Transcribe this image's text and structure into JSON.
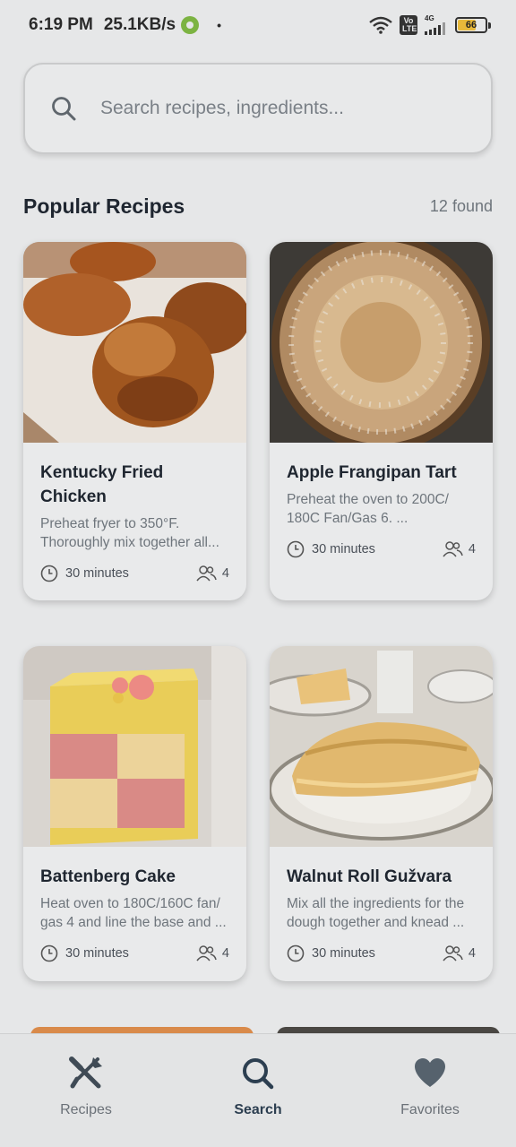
{
  "status_bar": {
    "time": "6:19 PM",
    "speed": "25.1KB/s",
    "network": "4G",
    "volte": "Vo LTE",
    "battery": "66",
    "battery_level": 0.66
  },
  "search": {
    "placeholder": "Search recipes, ingredients..."
  },
  "section": {
    "title": "Popular Recipes",
    "count": "12 found"
  },
  "recipes": [
    {
      "title": "Kentucky Fried Chicken",
      "description": "Preheat fryer to 350°F. Thoroughly mix together all...",
      "time": "30 minutes",
      "servings": "4"
    },
    {
      "title": "Apple Frangipan Tart",
      "description": "Preheat the oven to 200C/ 180C Fan/Gas 6. ...",
      "time": "30 minutes",
      "servings": "4"
    },
    {
      "title": "Battenberg Cake",
      "description": "Heat oven to 180C/160C fan/ gas 4 and line the base and ...",
      "time": "30 minutes",
      "servings": "4"
    },
    {
      "title": "Walnut Roll Gužvara",
      "description": "Mix all the ingredients for the dough together and knead ...",
      "time": "30 minutes",
      "servings": "4"
    }
  ],
  "nav": {
    "items": [
      {
        "label": "Recipes",
        "icon": "fork-knife-icon",
        "active": false
      },
      {
        "label": "Search",
        "icon": "search-icon",
        "active": true
      },
      {
        "label": "Favorites",
        "icon": "heart-icon",
        "active": false
      }
    ]
  },
  "colors": {
    "background": "#e6e7e8",
    "text_primary": "#1f2630",
    "text_secondary": "#6e757c",
    "nav_active": "#2c3e50"
  }
}
